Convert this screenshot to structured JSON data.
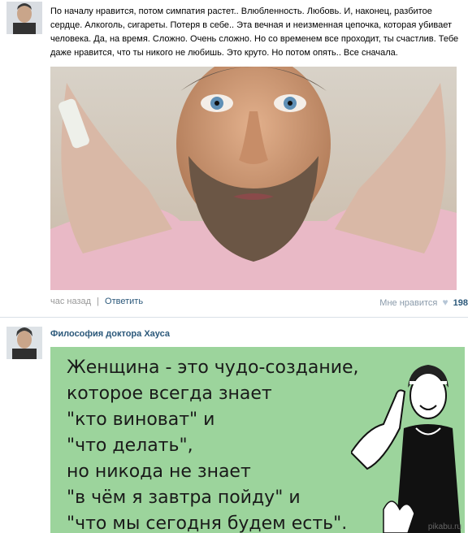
{
  "post1": {
    "text": "По началу нравится, потом симпатия растет.. Влюбленность. Любовь. И, наконец, разбитое сердце. Алкоголь, сигареты. Потеря в себе.. Эта вечная и неизменная цепочка, которая убивает человека. Да, на время. Сложно. Очень сложно. Но со временем все проходит, ты счастлив. Тебе даже нравится, что ты никого не любишь. Это круто. Но потом опять.. Все сначала.",
    "time": "час назад",
    "separator": "|",
    "reply_label": "Ответить",
    "like_label": "Мне нравится",
    "like_count": "198"
  },
  "post2": {
    "author": "Философия доктора Хауса",
    "meme_lines": [
      "Женщина - это чудо-создание,",
      "которое всегда знает",
      "\"кто виноват\" и",
      "\"что делать\",",
      "но никода не знает",
      "\"в чём я завтра пойду\" и",
      "\"что мы сегодня будем есть\"."
    ],
    "watermark": "pikabu.ru"
  },
  "colors": {
    "link": "#2b587a",
    "meme_bg": "#9cd49c",
    "divider": "#dae1e8"
  }
}
